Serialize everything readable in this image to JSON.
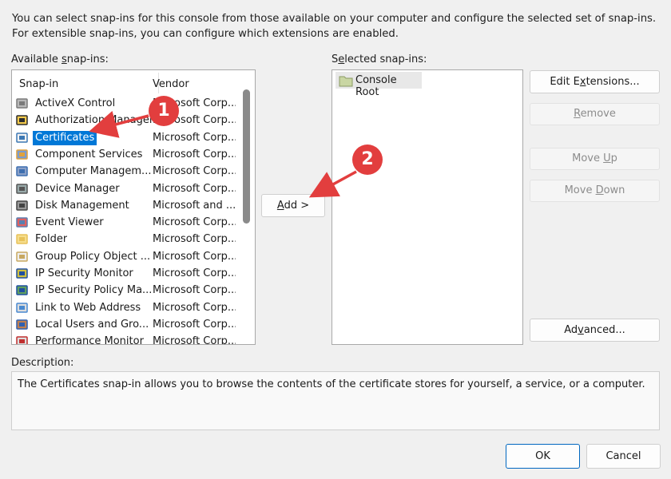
{
  "intro_text": "You can select snap-ins for this console from those available on your computer and configure the selected set of snap-ins. For extensible snap-ins, you can configure which extensions are enabled.",
  "available": {
    "label_prefix": "Available ",
    "label_u": "s",
    "label_suffix": "nap-ins:",
    "col_snapin": "Snap-in",
    "col_vendor": "Vendor",
    "rows": [
      {
        "name": "ActiveX Control",
        "vendor": "Microsoft Corp...",
        "icon": "activex-icon"
      },
      {
        "name": "Authorization Manager",
        "vendor": "Microsoft Corp...",
        "icon": "authorization-manager-icon"
      },
      {
        "name": "Certificates",
        "vendor": "Microsoft Corp...",
        "icon": "certificates-icon",
        "selected": true
      },
      {
        "name": "Component Services",
        "vendor": "Microsoft Corp...",
        "icon": "component-services-icon"
      },
      {
        "name": "Computer Managem...",
        "vendor": "Microsoft Corp...",
        "icon": "computer-management-icon"
      },
      {
        "name": "Device Manager",
        "vendor": "Microsoft Corp...",
        "icon": "device-manager-icon"
      },
      {
        "name": "Disk Management",
        "vendor": "Microsoft and ...",
        "icon": "disk-management-icon"
      },
      {
        "name": "Event Viewer",
        "vendor": "Microsoft Corp...",
        "icon": "event-viewer-icon"
      },
      {
        "name": "Folder",
        "vendor": "Microsoft Corp...",
        "icon": "folder-icon"
      },
      {
        "name": "Group Policy Object ...",
        "vendor": "Microsoft Corp...",
        "icon": "group-policy-icon"
      },
      {
        "name": "IP Security Monitor",
        "vendor": "Microsoft Corp...",
        "icon": "ip-security-monitor-icon"
      },
      {
        "name": "IP Security Policy Ma...",
        "vendor": "Microsoft Corp...",
        "icon": "ip-security-policy-icon"
      },
      {
        "name": "Link to Web Address",
        "vendor": "Microsoft Corp...",
        "icon": "link-web-icon"
      },
      {
        "name": "Local Users and Gro...",
        "vendor": "Microsoft Corp...",
        "icon": "local-users-icon"
      },
      {
        "name": "Performance Monitor",
        "vendor": "Microsoft Corp...",
        "icon": "performance-monitor-icon"
      }
    ]
  },
  "add_button": {
    "u": "A",
    "rest": "dd >"
  },
  "selected": {
    "label_prefix": "S",
    "label_u": "e",
    "label_suffix": "lected snap-ins:",
    "root_item": "Console Root"
  },
  "buttons": {
    "edit_extensions": {
      "pre": "Edit E",
      "u": "x",
      "post": "tensions..."
    },
    "remove": {
      "pre": "",
      "u": "R",
      "post": "emove"
    },
    "move_up": {
      "pre": "Move ",
      "u": "U",
      "post": "p"
    },
    "move_down": {
      "pre": "Move ",
      "u": "D",
      "post": "own"
    },
    "advanced": {
      "pre": "Ad",
      "u": "v",
      "post": "anced..."
    },
    "ok": "OK",
    "cancel": "Cancel"
  },
  "description": {
    "label": "Description:",
    "text": "The Certificates snap-in allows you to browse the contents of the certificate stores for yourself, a service, or a computer."
  },
  "annotations": {
    "callout_1": "1",
    "callout_2": "2",
    "color": "#e23e3e"
  },
  "colors": {
    "selection": "#0078d7",
    "background": "#f0f0f0"
  }
}
